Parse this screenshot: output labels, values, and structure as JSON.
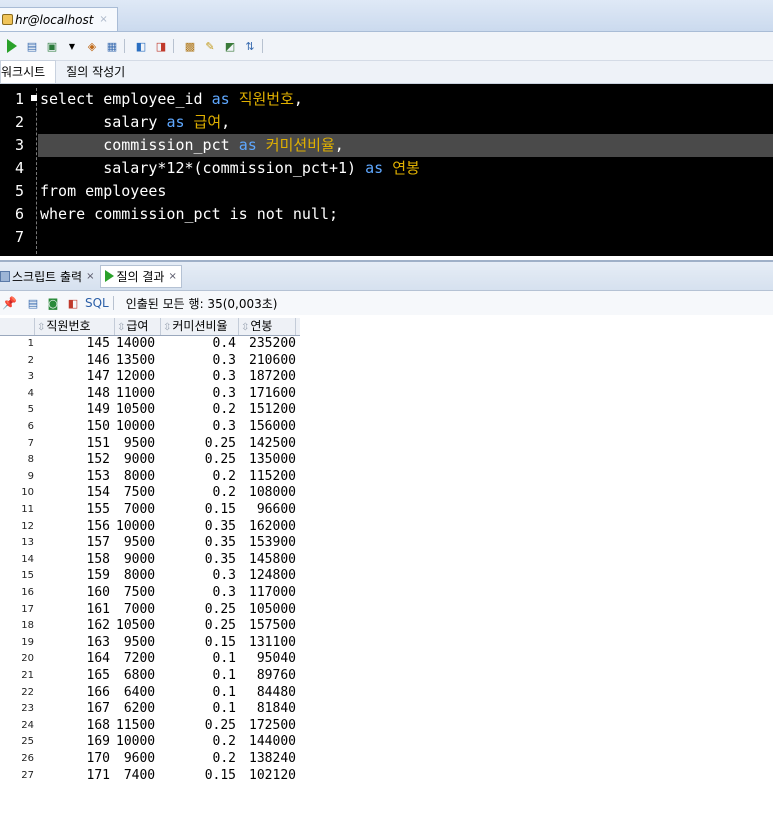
{
  "doc_tab": {
    "title": "hr@localhost",
    "close": "×"
  },
  "sub_tabs": [
    "워크시트",
    "질의 작성기"
  ],
  "editor": {
    "lines": [
      {
        "n": "1",
        "parts": [
          {
            "t": "select employee_id ",
            "c": ""
          },
          {
            "t": "as ",
            "c": "kw"
          },
          {
            "t": "직원번호",
            "c": "kor"
          },
          {
            "t": ",",
            "c": ""
          }
        ]
      },
      {
        "n": "2",
        "parts": [
          {
            "t": "       salary ",
            "c": ""
          },
          {
            "t": "as ",
            "c": "kw"
          },
          {
            "t": "급여",
            "c": "kor"
          },
          {
            "t": ",",
            "c": ""
          }
        ]
      },
      {
        "n": "3",
        "parts": [
          {
            "t": "       commission_pct ",
            "c": ""
          },
          {
            "t": "as ",
            "c": "kw"
          },
          {
            "t": "커미션비율",
            "c": "kor"
          },
          {
            "t": ",",
            "c": ""
          }
        ]
      },
      {
        "n": "4",
        "parts": [
          {
            "t": "       salary*12*(commission_pct+1) ",
            "c": ""
          },
          {
            "t": "as ",
            "c": "kw"
          },
          {
            "t": "연봉",
            "c": "kor"
          }
        ]
      },
      {
        "n": "5",
        "parts": [
          {
            "t": "from employees",
            "c": ""
          }
        ]
      },
      {
        "n": "6",
        "parts": [
          {
            "t": "where commission_pct is not null;",
            "c": ""
          }
        ]
      },
      {
        "n": "7",
        "parts": []
      }
    ]
  },
  "results_tabs": [
    {
      "label": "스크립트 출력",
      "close": "×"
    },
    {
      "label": "질의 결과",
      "close": "×"
    }
  ],
  "results_toolbar": {
    "sql": "SQL",
    "status": "인출된 모든 행: 35(0,003초)"
  },
  "grid": {
    "columns": [
      "직원번호",
      "급여",
      "커미션비율",
      "연봉"
    ],
    "rows": [
      [
        "1",
        "145",
        "14000",
        "0.4",
        "235200"
      ],
      [
        "2",
        "146",
        "13500",
        "0.3",
        "210600"
      ],
      [
        "3",
        "147",
        "12000",
        "0.3",
        "187200"
      ],
      [
        "4",
        "148",
        "11000",
        "0.3",
        "171600"
      ],
      [
        "5",
        "149",
        "10500",
        "0.2",
        "151200"
      ],
      [
        "6",
        "150",
        "10000",
        "0.3",
        "156000"
      ],
      [
        "7",
        "151",
        " 9500",
        "0.25",
        "142500"
      ],
      [
        "8",
        "152",
        " 9000",
        "0.25",
        "135000"
      ],
      [
        "9",
        "153",
        " 8000",
        "0.2",
        "115200"
      ],
      [
        "10",
        "154",
        " 7500",
        "0.2",
        "108000"
      ],
      [
        "11",
        "155",
        " 7000",
        "0.15",
        " 96600"
      ],
      [
        "12",
        "156",
        "10000",
        "0.35",
        "162000"
      ],
      [
        "13",
        "157",
        " 9500",
        "0.35",
        "153900"
      ],
      [
        "14",
        "158",
        " 9000",
        "0.35",
        "145800"
      ],
      [
        "15",
        "159",
        " 8000",
        "0.3",
        "124800"
      ],
      [
        "16",
        "160",
        " 7500",
        "0.3",
        "117000"
      ],
      [
        "17",
        "161",
        " 7000",
        "0.25",
        "105000"
      ],
      [
        "18",
        "162",
        "10500",
        "0.25",
        "157500"
      ],
      [
        "19",
        "163",
        " 9500",
        "0.15",
        "131100"
      ],
      [
        "20",
        "164",
        " 7200",
        "0.1",
        " 95040"
      ],
      [
        "21",
        "165",
        " 6800",
        "0.1",
        " 89760"
      ],
      [
        "22",
        "166",
        " 6400",
        "0.1",
        " 84480"
      ],
      [
        "23",
        "167",
        " 6200",
        "0.1",
        " 81840"
      ],
      [
        "24",
        "168",
        "11500",
        "0.25",
        "172500"
      ],
      [
        "25",
        "169",
        "10000",
        "0.2",
        "144000"
      ],
      [
        "26",
        "170",
        " 9600",
        "0.2",
        "138240"
      ],
      [
        "27",
        "171",
        " 7400",
        "0.15",
        "102120"
      ]
    ]
  }
}
